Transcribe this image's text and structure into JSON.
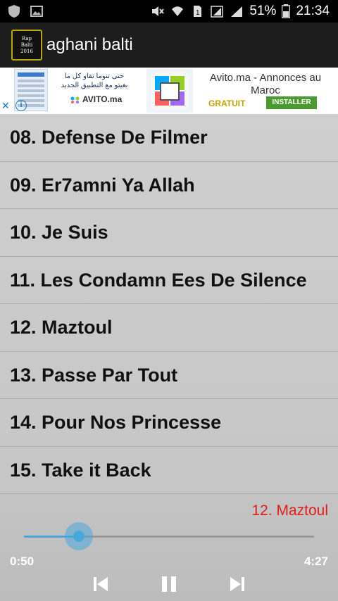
{
  "status_bar": {
    "battery": "51%",
    "time": "21:34"
  },
  "app_bar": {
    "title": "aghani balti",
    "logo_lines": [
      "Rap",
      "Balti",
      "2016"
    ]
  },
  "ad": {
    "arabic_line_1": "حتى تنوما تقاو كل ما",
    "arabic_line_2": "بغيتو مع التطبيق الجديد",
    "brand": "AVITO.ma",
    "headline": "Avito.ma - Annonces au Maroc",
    "price_label": "GRATUIT",
    "install_label": "INSTALLER",
    "close_glyph": "✕",
    "info_glyph": "i"
  },
  "tracks": [
    "08. Defense De Filmer",
    "09. Er7amni Ya Allah",
    "10. Je Suis",
    "11. Les Condamn Ees De Silence",
    "12. Maztoul",
    "13. Passe Par Tout",
    "14. Pour Nos Princesse",
    "15. Take it Back"
  ],
  "player": {
    "now_playing": "12. Maztoul",
    "current_time": "0:50",
    "total_time": "4:27",
    "progress": 0.19,
    "accent_color": "#4aa7dc",
    "title_color": "#e21b1b",
    "icons": [
      "previous-icon",
      "pause-icon",
      "next-icon"
    ]
  }
}
